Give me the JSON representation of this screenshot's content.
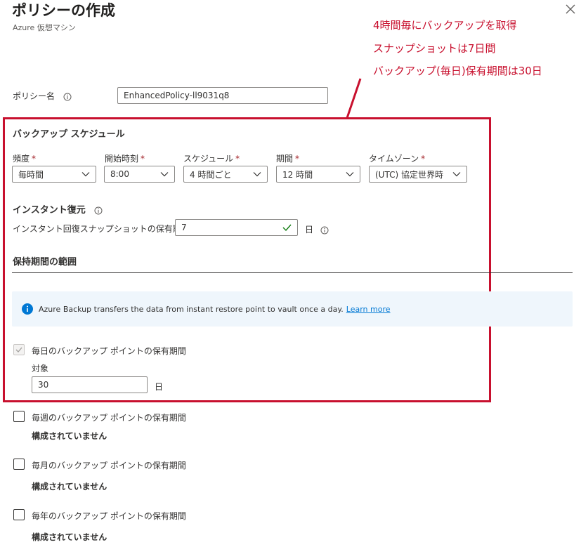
{
  "header": {
    "title": "ポリシーの作成",
    "subtitle": "Azure 仮想マシン"
  },
  "annotations": [
    "4時間毎にバックアップを取得",
    "スナップショットは7日間",
    "バックアップ(毎日)保有期間は30日"
  ],
  "policy_name": {
    "label": "ポリシー名",
    "value": "EnhancedPolicy-ll9031q8"
  },
  "schedule": {
    "heading": "バックアップ スケジュール",
    "required_mark": "*",
    "fields": [
      {
        "label": "頻度",
        "value": "毎時間"
      },
      {
        "label": "開始時刻",
        "value": "8:00"
      },
      {
        "label": "スケジュール",
        "value": "4 時間ごと"
      },
      {
        "label": "期間",
        "value": "12 時間"
      },
      {
        "label": "タイムゾーン",
        "value": "(UTC) 協定世界時"
      }
    ]
  },
  "instant_restore": {
    "heading": "インスタント復元",
    "label": "インスタント回復スナップショットの保有期間",
    "value": "7",
    "unit": "日"
  },
  "retention": {
    "heading": "保持期間の範囲",
    "info_text": "Azure Backup transfers the data from instant restore point to vault once a day.",
    "info_link": "Learn more",
    "daily": {
      "label": "毎日のバックアップ ポイントの保有期間",
      "checked": true,
      "target_label": "対象",
      "value": "30",
      "unit": "日"
    },
    "weekly": {
      "label": "毎週のバックアップ ポイントの保有期間",
      "status": "構成されていません"
    },
    "monthly": {
      "label": "毎月のバックアップ ポイントの保有期間",
      "status": "構成されていません"
    },
    "yearly": {
      "label": "毎年のバックアップ ポイントの保有期間",
      "status": "構成されていません"
    }
  },
  "colors": {
    "annotation": "#c8102e",
    "accent": "#0078d4",
    "info_background": "#eff6fc"
  }
}
